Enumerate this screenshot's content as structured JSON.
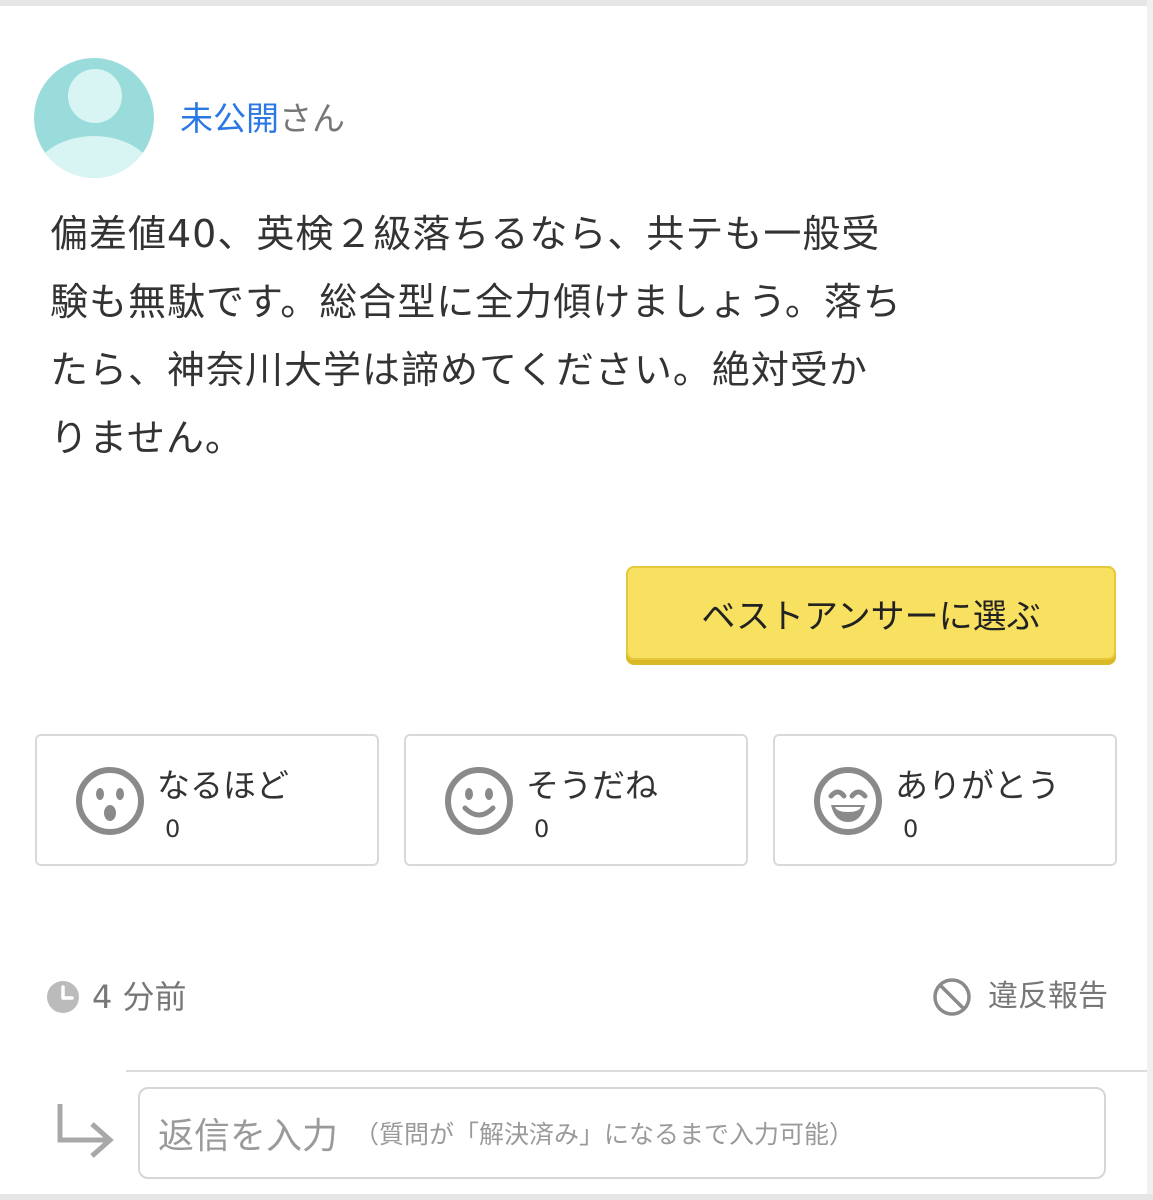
{
  "author": {
    "name": "未公開",
    "suffix": "さん"
  },
  "answer": {
    "text": "偏差値40、英検２級落ちるなら、共テも一般受\n験も無駄です。総合型に全力傾けましょう。落ち\nたら、神奈川大学は諦めてください。絶対受か\nりません。"
  },
  "best_answer_button": {
    "label": "ベストアンサーに選ぶ"
  },
  "reactions": [
    {
      "label": "なるほど",
      "count": "0",
      "icon": "surprised-face-icon"
    },
    {
      "label": "そうだね",
      "count": "0",
      "icon": "smile-face-icon"
    },
    {
      "label": "ありがとう",
      "count": "0",
      "icon": "grin-face-icon"
    }
  ],
  "meta": {
    "time": "4 分前",
    "report_label": "違反報告"
  },
  "reply": {
    "placeholder": "返信を入力",
    "placeholder_note": "（質問が「解決済み」になるまで入力可能）"
  },
  "colors": {
    "author_link": "#2b78e4",
    "button_yellow": "#f8e060",
    "avatar_teal": "#9adcdc",
    "icon_gray": "#8a8a8a"
  }
}
